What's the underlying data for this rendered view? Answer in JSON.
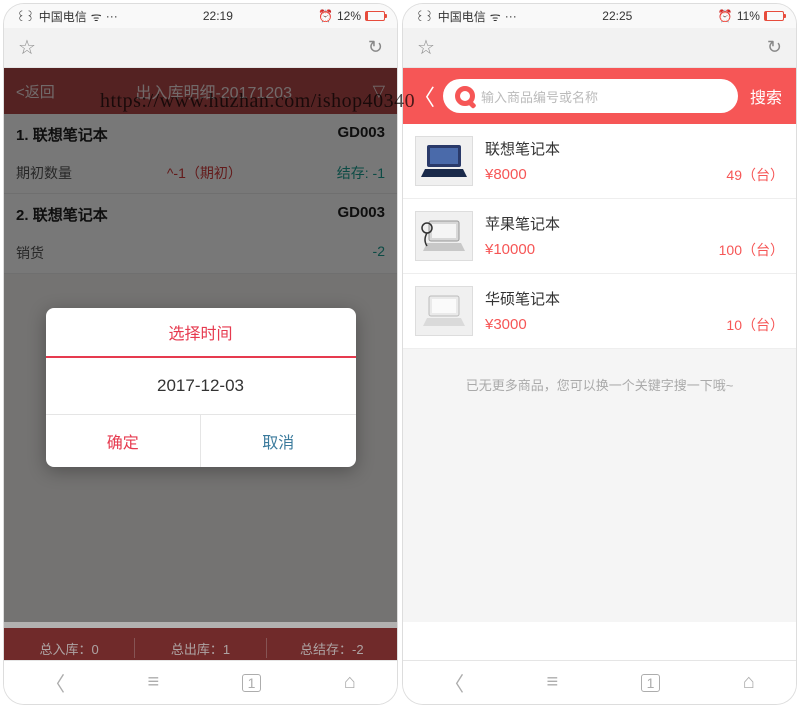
{
  "watermark": "https://www.huzhan.com/ishop40340",
  "left": {
    "status": {
      "carrier": "中国电信",
      "time": "22:19",
      "battery": "12%"
    },
    "header": {
      "back": "<返回",
      "title": "出入库明细-20171203"
    },
    "items": [
      {
        "idx": "1.",
        "name": "联想笔记本",
        "code": "GD003",
        "label": "期初数量",
        "mid": "^-1（期初）",
        "stock_label": "结存:",
        "stock_val": "-1"
      },
      {
        "idx": "2.",
        "name": "联想笔记本",
        "code": "GD003",
        "label": "销货",
        "mid": "",
        "stock_label": "",
        "stock_val": "-2"
      }
    ],
    "footer": {
      "in": "总入库：0",
      "out": "总出库：1",
      "stock": "总结存：-2"
    },
    "dialog": {
      "title": "选择时间",
      "date": "2017-12-03",
      "confirm": "确定",
      "cancel": "取消"
    }
  },
  "right": {
    "status": {
      "carrier": "中国电信",
      "time": "22:25",
      "battery": "11%"
    },
    "search": {
      "placeholder": "输入商品编号或名称",
      "btn": "搜索"
    },
    "products": [
      {
        "name": "联想笔记本",
        "price": "¥8000",
        "stock": "49（台）"
      },
      {
        "name": "苹果笔记本",
        "price": "¥10000",
        "stock": "100（台）"
      },
      {
        "name": "华硕笔记本",
        "price": "¥3000",
        "stock": "10（台）"
      }
    ],
    "no_more": "已无更多商品，您可以换一个关键字搜一下哦~"
  }
}
